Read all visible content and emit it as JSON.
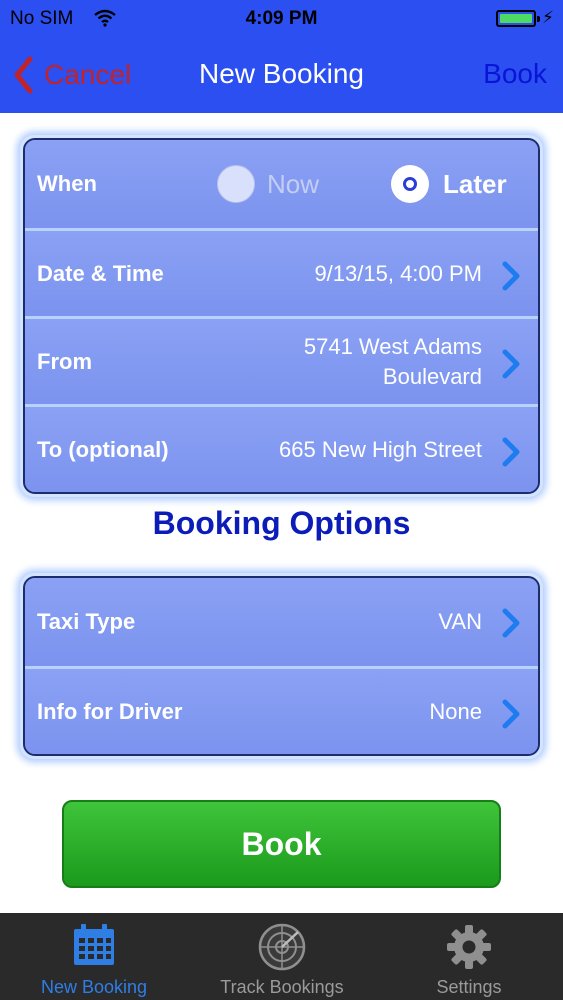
{
  "status_bar": {
    "carrier": "No SIM",
    "time": "4:09 PM"
  },
  "nav": {
    "back_label": "Cancel",
    "title": "New Booking",
    "action_label": "Book"
  },
  "when": {
    "label": "When",
    "options": [
      "Now",
      "Later"
    ],
    "selected": "Later"
  },
  "trip_rows": [
    {
      "label": "Date & Time",
      "value": "9/13/15, 4:00 PM"
    },
    {
      "label": "From",
      "value_line1": "5741 West Adams",
      "value_line2": "Boulevard"
    },
    {
      "label": "To (optional)",
      "value": "665 New High Street"
    }
  ],
  "section_title": "Booking Options",
  "option_rows": [
    {
      "label": "Taxi Type",
      "value": "VAN"
    },
    {
      "label": "Info for Driver",
      "value": "None"
    }
  ],
  "book_button_label": "Book",
  "tabs": [
    {
      "label": "New Booking",
      "icon": "calendar-icon",
      "active": true
    },
    {
      "label": "Track Bookings",
      "icon": "radar-icon",
      "active": false
    },
    {
      "label": "Settings",
      "icon": "gear-icon",
      "active": false
    }
  ],
  "colors": {
    "nav_bar": "#2b4ff0",
    "cancel": "#c0232a",
    "book_nav": "#0a14d8",
    "row": "#8097f0",
    "book_button": "#2bb02a",
    "tab_active": "#2f7ee6"
  }
}
